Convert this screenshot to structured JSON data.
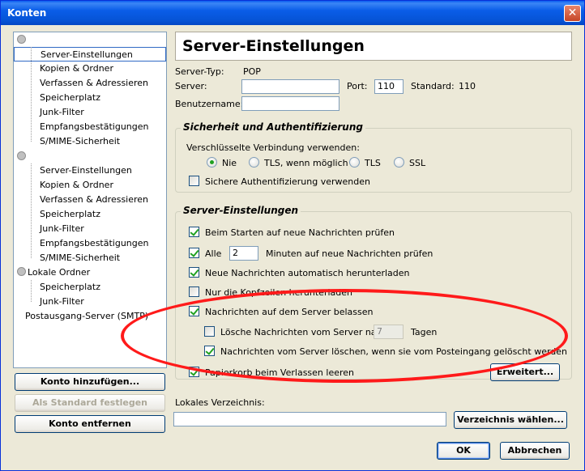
{
  "window": {
    "title": "Konten",
    "close_glyph": "✕"
  },
  "tree": {
    "account1_label": "",
    "account1_items": [
      "Server-Einstellungen",
      "Kopien & Ordner",
      "Verfassen & Adressieren",
      "Speicherplatz",
      "Junk-Filter",
      "Empfangsbestätigungen",
      "S/MIME-Sicherheit"
    ],
    "account2_label": "",
    "account2_items": [
      "Server-Einstellungen",
      "Kopien & Ordner",
      "Verfassen & Adressieren",
      "Speicherplatz",
      "Junk-Filter",
      "Empfangsbestätigungen",
      "S/MIME-Sicherheit"
    ],
    "local_label": "Lokale Ordner",
    "local_items": [
      "Speicherplatz",
      "Junk-Filter"
    ],
    "smtp_label": "Postausgang-Server (SMTP)"
  },
  "left_buttons": {
    "add": "Konto hinzufügen...",
    "default": "Als Standard festlegen",
    "remove": "Konto entfernen"
  },
  "page": {
    "title": "Server-Einstellungen",
    "server_type_label": "Server-Typ:",
    "server_type_value": "POP",
    "server_label": "Server:",
    "server_value": "",
    "port_label": "Port:",
    "port_value": "110",
    "standard_label": "Standard:",
    "standard_value": "110",
    "username_label": "Benutzername:",
    "username_value": ""
  },
  "security": {
    "title": "Sicherheit und Authentifizierung",
    "encrypted_label": "Verschlüsselte Verbindung verwenden:",
    "options": [
      "Nie",
      "TLS, wenn möglich",
      "TLS",
      "SSL"
    ],
    "selected": "Nie",
    "secure_auth_label": "Sichere Authentifizierung verwenden",
    "secure_auth_checked": false
  },
  "server_settings": {
    "title": "Server-Einstellungen",
    "check_on_start": "Beim Starten auf neue Nachrichten prüfen",
    "every_label": "Alle",
    "every_value": "2",
    "every_suffix": "Minuten auf neue Nachrichten prüfen",
    "auto_download": "Neue Nachrichten automatisch herunterladen",
    "headers_only": "Nur die Kopfzeilen herunterladen",
    "leave_on_server": "Nachrichten auf dem Server belassen",
    "delete_after_label": "Lösche Nachrichten vom Server nach",
    "delete_after_value": "7",
    "delete_after_unit": "Tagen",
    "delete_when_deleted": "Nachrichten vom Server löschen, wenn sie vom Posteingang gelöscht werden",
    "empty_trash": "Papierkorb beim Verlassen leeren",
    "advanced_button": "Erweitert..."
  },
  "local_dir": {
    "label": "Lokales Verzeichnis:",
    "value": "",
    "choose_button": "Verzeichnis wählen..."
  },
  "footer": {
    "ok": "OK",
    "cancel": "Abbrechen"
  },
  "colors": {
    "annotation": "#ff1a1a",
    "titlebar": "#0a5de8",
    "checkmark": "#21a121"
  }
}
